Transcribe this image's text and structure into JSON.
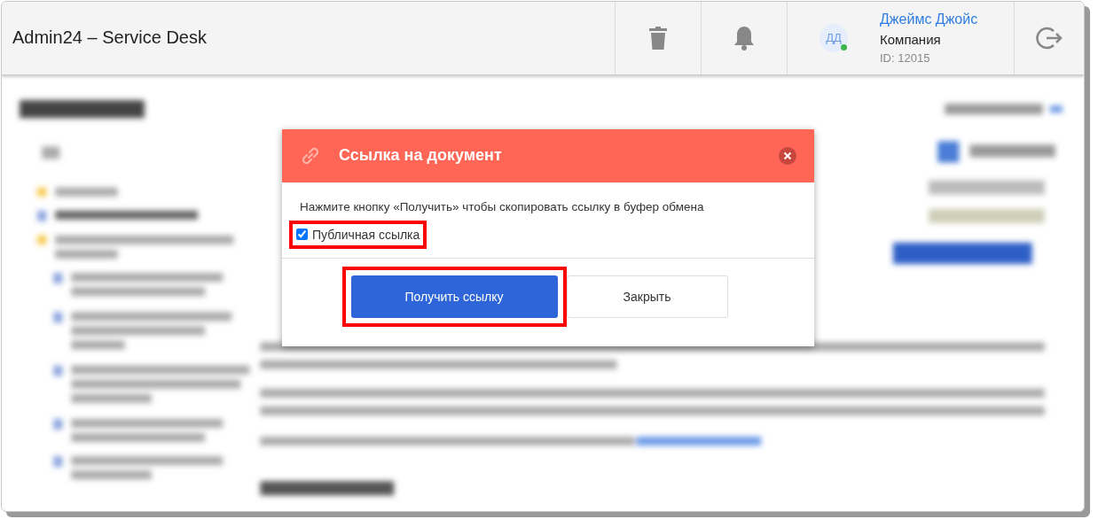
{
  "header": {
    "title": "Admin24 – Service Desk",
    "user": {
      "initials": "ДД",
      "online": true,
      "name": "Джеймс Джойс",
      "company": "Компания",
      "id": "ID: 12015"
    }
  },
  "dialog": {
    "title": "Ссылка на документ",
    "message": "Нажмите кнопку «Получить» чтобы скопировать ссылку в буфер обмена",
    "checkbox": {
      "label": "Публичная ссылка",
      "checked": true,
      "highlighted": true
    },
    "buttons": [
      {
        "label": "Получить ссылку",
        "kind": "primary",
        "highlighted": true
      },
      {
        "label": "Закрыть",
        "kind": "secondary",
        "highlighted": false
      }
    ]
  }
}
